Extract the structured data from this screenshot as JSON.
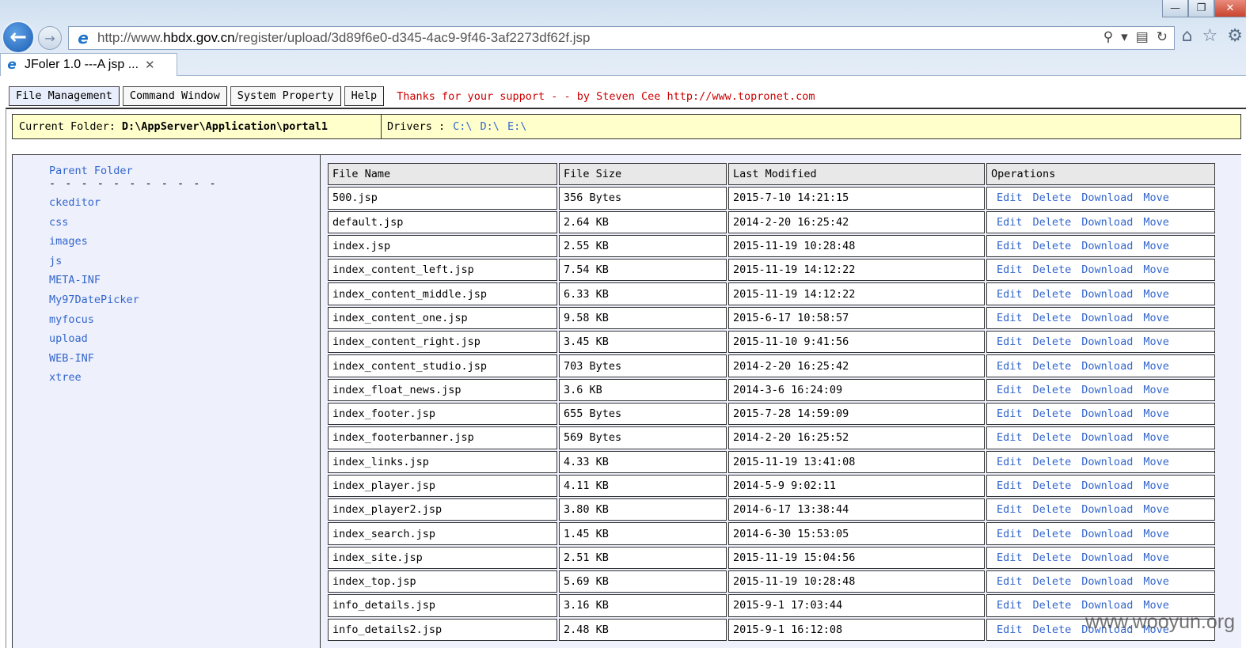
{
  "browser": {
    "window_buttons": [
      "—",
      "❐",
      "✕"
    ],
    "back_glyph": "←",
    "forward_glyph": "→",
    "url_prefix": "http://www.",
    "url_host": "hbdx.gov.cn",
    "url_path": "/register/upload/3d89f6e0-d345-4ac9-9f46-3af2273df62f.jsp",
    "tab_title": "JFoler 1.0 ---A jsp ...",
    "tab_close": "✕",
    "icons": [
      "search-icon",
      "dropdown-icon",
      "compat-icon",
      "refresh-icon",
      "home-icon",
      "favorites-icon",
      "settings-icon"
    ]
  },
  "menu": {
    "items": [
      "File Management",
      "Command Window",
      "System Property",
      "Help"
    ],
    "thanks": "Thanks for your support - - by Steven Cee http://www.topronet.com"
  },
  "folder_bar": {
    "current_label": "Current Folder:",
    "current_value": "D:\\AppServer\\Application\\portal1",
    "drivers_label": "Drivers :",
    "drivers": [
      "C:\\",
      "D:\\",
      "E:\\"
    ]
  },
  "sidebar": {
    "parent": "Parent Folder",
    "dashes": "- - - - - - - - - - -",
    "folders": [
      "ckeditor",
      "css",
      "images",
      "js",
      "META-INF",
      "My97DatePicker",
      "myfocus",
      "upload",
      "WEB-INF",
      "xtree"
    ]
  },
  "table": {
    "headers": [
      "File Name",
      "File Size",
      "Last Modified",
      "Operations"
    ],
    "ops": [
      "Edit",
      "Delete",
      "Download",
      "Move"
    ],
    "rows": [
      [
        "500.jsp",
        "356 Bytes",
        "2015-7-10 14:21:15"
      ],
      [
        "default.jsp",
        "2.64 KB",
        "2014-2-20 16:25:42"
      ],
      [
        "index.jsp",
        "2.55 KB",
        "2015-11-19 10:28:48"
      ],
      [
        "index_content_left.jsp",
        "7.54 KB",
        "2015-11-19 14:12:22"
      ],
      [
        "index_content_middle.jsp",
        "6.33 KB",
        "2015-11-19 14:12:22"
      ],
      [
        "index_content_one.jsp",
        "9.58 KB",
        "2015-6-17 10:58:57"
      ],
      [
        "index_content_right.jsp",
        "3.45 KB",
        "2015-11-10 9:41:56"
      ],
      [
        "index_content_studio.jsp",
        "703 Bytes",
        "2014-2-20 16:25:42"
      ],
      [
        "index_float_news.jsp",
        "3.6 KB",
        "2014-3-6 16:24:09"
      ],
      [
        "index_footer.jsp",
        "655 Bytes",
        "2015-7-28 14:59:09"
      ],
      [
        "index_footerbanner.jsp",
        "569 Bytes",
        "2014-2-20 16:25:52"
      ],
      [
        "index_links.jsp",
        "4.33 KB",
        "2015-11-19 13:41:08"
      ],
      [
        "index_player.jsp",
        "4.11 KB",
        "2014-5-9 9:02:11"
      ],
      [
        "index_player2.jsp",
        "3.80 KB",
        "2014-6-17 13:38:44"
      ],
      [
        "index_search.jsp",
        "1.45 KB",
        "2014-6-30 15:53:05"
      ],
      [
        "index_site.jsp",
        "2.51 KB",
        "2015-11-19 15:04:56"
      ],
      [
        "index_top.jsp",
        "5.69 KB",
        "2015-11-19 10:28:48"
      ],
      [
        "info_details.jsp",
        "3.16 KB",
        "2015-9-1 17:03:44"
      ],
      [
        "info_details2.jsp",
        "2.48 KB",
        "2015-9-1 16:12:08"
      ]
    ]
  },
  "watermark": "www.wooyun.org"
}
